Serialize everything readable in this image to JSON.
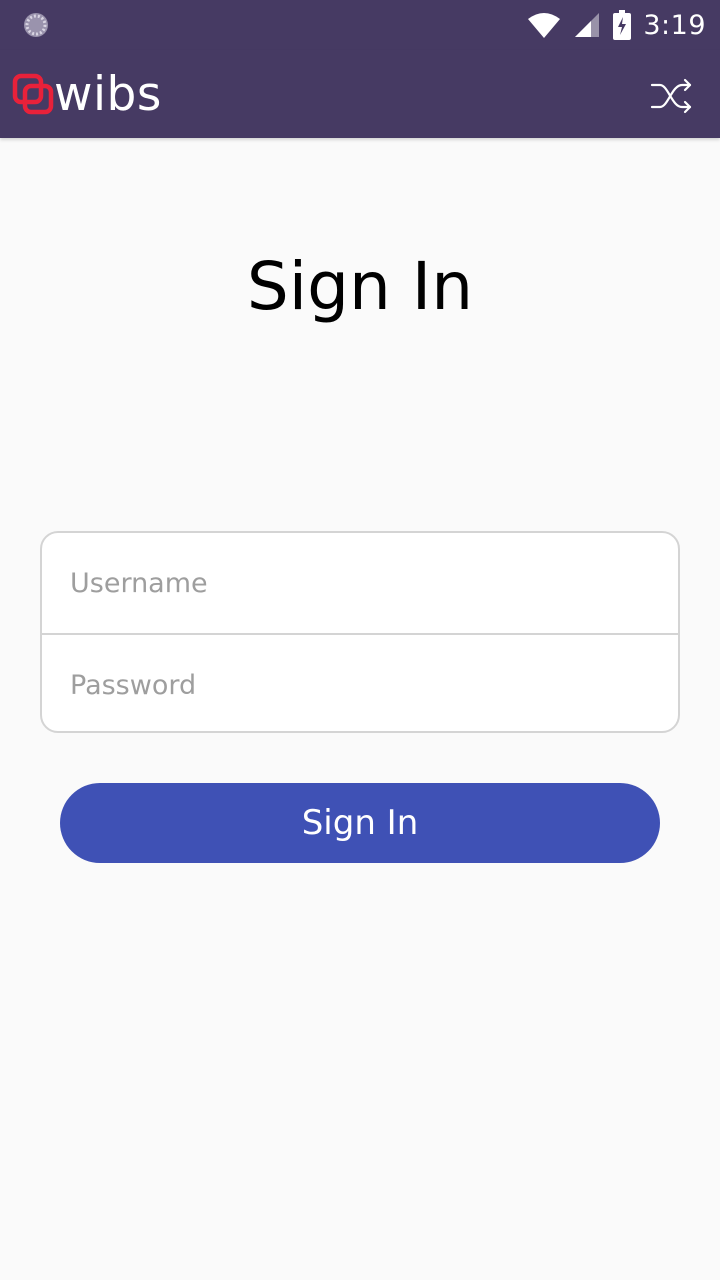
{
  "status_bar": {
    "time": "3:19",
    "icons": [
      "loading-spinner-icon",
      "wifi-icon",
      "cell-signal-icon",
      "battery-charging-icon"
    ]
  },
  "app_bar": {
    "logo_text": "wibs",
    "action_icon": "shuffle-icon",
    "background_color": "#463a63",
    "logo_mark_color": "#e8213a"
  },
  "main": {
    "title": "Sign In",
    "username": {
      "value": "",
      "placeholder": "Username"
    },
    "password": {
      "value": "",
      "placeholder": "Password"
    },
    "submit_label": "Sign In",
    "submit_color": "#3f51b5"
  }
}
